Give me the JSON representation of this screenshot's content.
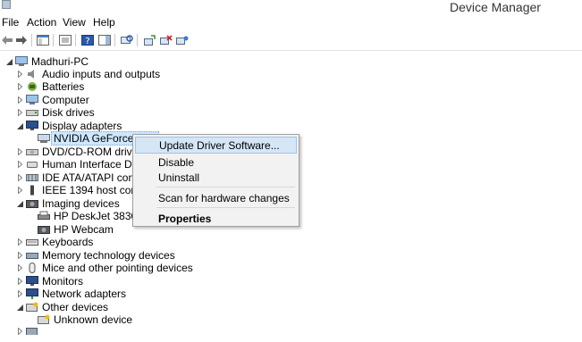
{
  "window": {
    "title": "Device Manager"
  },
  "menu": [
    "File",
    "Action",
    "View",
    "Help"
  ],
  "tree": {
    "root": "Madhuri-PC",
    "items": [
      {
        "label": "Audio inputs and outputs",
        "icon": "speaker-icon",
        "expanded": false
      },
      {
        "label": "Batteries",
        "icon": "battery-icon",
        "expanded": false
      },
      {
        "label": "Computer",
        "icon": "computer-icon",
        "expanded": false
      },
      {
        "label": "Disk drives",
        "icon": "disk-drive-icon",
        "expanded": false
      },
      {
        "label": "Display adapters",
        "icon": "monitor-icon",
        "expanded": true
      },
      {
        "label": "NVIDIA GeForce G10",
        "icon": "display-adapter-icon",
        "child": true,
        "selected": true
      },
      {
        "label": "DVD/CD-ROM drives",
        "icon": "dvd-drive-icon",
        "expanded": false
      },
      {
        "label": "Human Interface Device",
        "icon": "hid-icon",
        "expanded": false
      },
      {
        "label": "IDE ATA/ATAPI controlle",
        "icon": "ide-controller-icon",
        "expanded": false
      },
      {
        "label": "IEEE 1394 host controller",
        "icon": "firewire-icon",
        "expanded": false
      },
      {
        "label": "Imaging devices",
        "icon": "camera-icon",
        "expanded": true
      },
      {
        "label": "HP DeskJet 3830 serie",
        "icon": "printer-icon",
        "child": true
      },
      {
        "label": "HP Webcam",
        "icon": "webcam-icon",
        "child": true
      },
      {
        "label": "Keyboards",
        "icon": "keyboard-icon",
        "expanded": false
      },
      {
        "label": "Memory technology devices",
        "icon": "memory-icon",
        "expanded": false
      },
      {
        "label": "Mice and other pointing devices",
        "icon": "mouse-icon",
        "expanded": false
      },
      {
        "label": "Monitors",
        "icon": "monitor-icon",
        "expanded": false
      },
      {
        "label": "Network adapters",
        "icon": "network-icon",
        "expanded": false
      },
      {
        "label": "Other devices",
        "icon": "unknown-device-icon",
        "expanded": true
      },
      {
        "label": "Unknown device",
        "icon": "unknown-device-icon",
        "child": true
      }
    ]
  },
  "context_menu": {
    "items": [
      {
        "label": "Update Driver Software...",
        "highlighted": true
      },
      {
        "label": "Disable"
      },
      {
        "label": "Uninstall"
      },
      {
        "separator": true
      },
      {
        "label": "Scan for hardware changes"
      },
      {
        "separator": true
      },
      {
        "label": "Properties",
        "bold": true
      }
    ]
  },
  "colors": {
    "selection": "#cde8ff",
    "menu_highlight": "#d5e6f7",
    "menu_bg": "#f2f2f2"
  }
}
